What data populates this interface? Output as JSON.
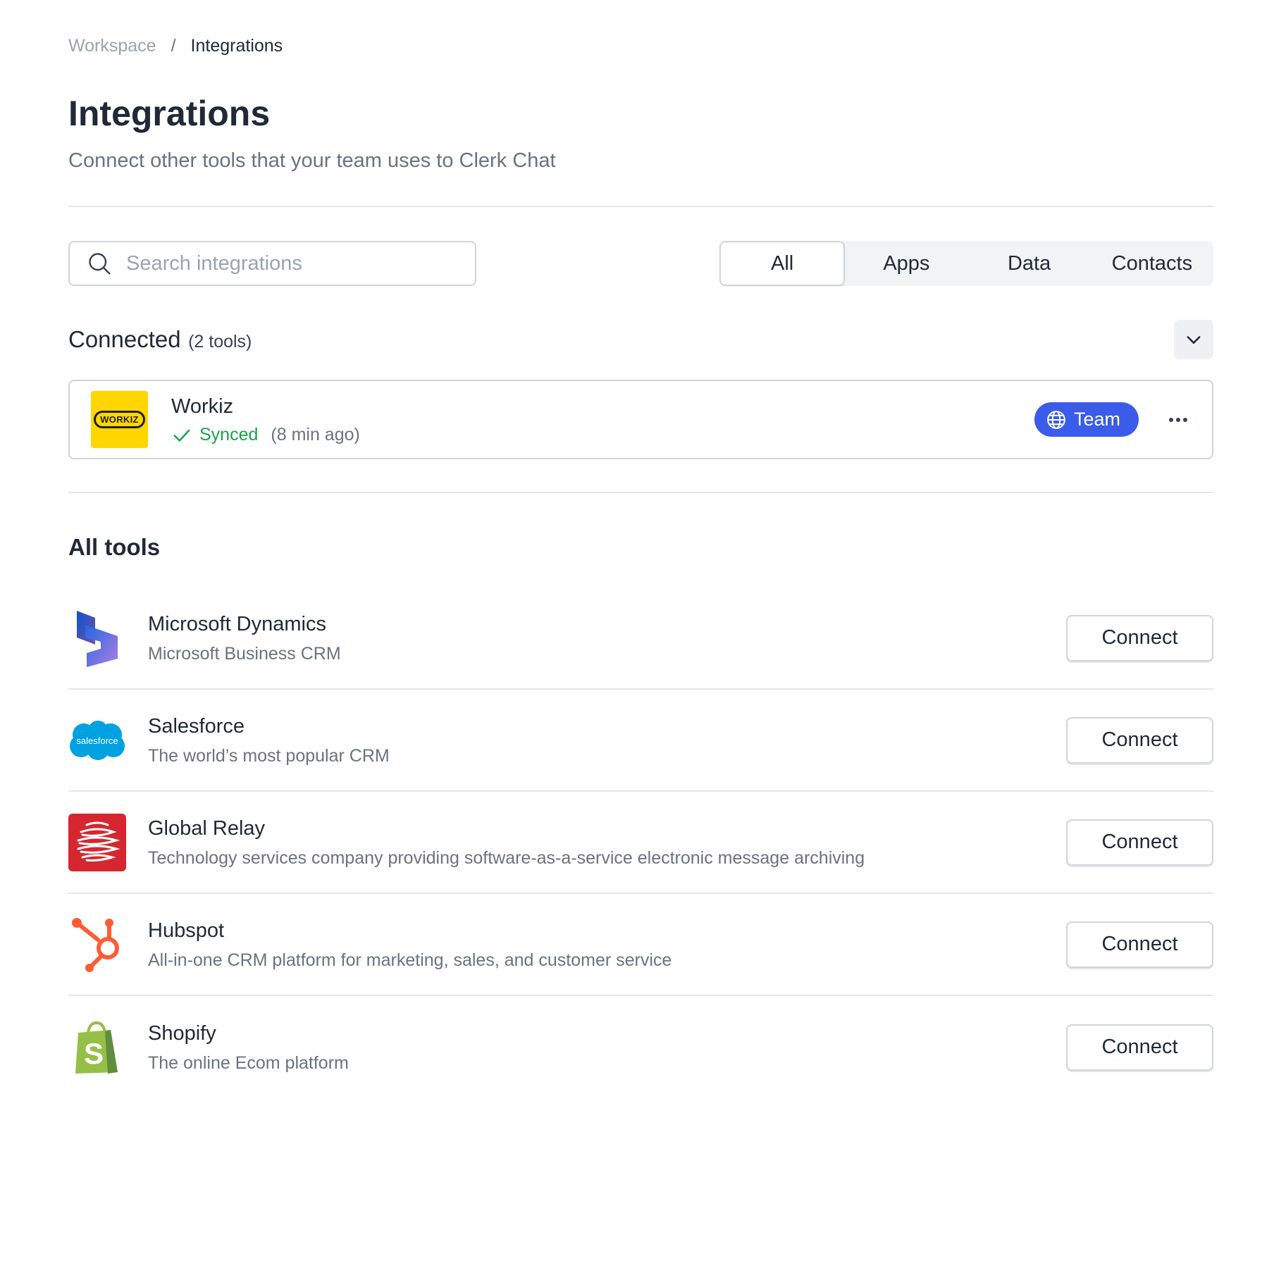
{
  "breadcrumb": {
    "parent": "Workspace",
    "separator": "/",
    "current": "Integrations"
  },
  "header": {
    "title": "Integrations",
    "subtitle": "Connect other tools that your team uses to Clerk Chat"
  },
  "search": {
    "placeholder": "Search integrations",
    "value": ""
  },
  "filters": {
    "tabs": [
      {
        "label": "All",
        "active": true
      },
      {
        "label": "Apps",
        "active": false
      },
      {
        "label": "Data",
        "active": false
      },
      {
        "label": "Contacts",
        "active": false
      }
    ]
  },
  "connected": {
    "title": "Connected",
    "count": "(2 tools)",
    "items": [
      {
        "name": "Workiz",
        "logo_text": "WORKIZ",
        "status": "Synced",
        "time": "(8 min ago)",
        "badge": "Team"
      }
    ]
  },
  "all_tools": {
    "title": "All tools",
    "items": [
      {
        "name": "Microsoft Dynamics",
        "description": "Microsoft Business CRM",
        "action": "Connect",
        "icon": "microsoft-dynamics-icon"
      },
      {
        "name": "Salesforce",
        "description": "The world’s most popular CRM",
        "action": "Connect",
        "icon": "salesforce-icon",
        "logo_text": "salesforce"
      },
      {
        "name": "Global Relay",
        "description": "Technology services company providing software-as-a-service electronic message archiving",
        "action": "Connect",
        "icon": "global-relay-icon"
      },
      {
        "name": "Hubspot",
        "description": "All-in-one CRM platform for marketing, sales, and customer service",
        "action": "Connect",
        "icon": "hubspot-icon"
      },
      {
        "name": "Shopify",
        "description": "The online Ecom platform",
        "action": "Connect",
        "icon": "shopify-icon"
      }
    ]
  },
  "colors": {
    "accent": "#3b5bea",
    "success": "#16a34a",
    "workiz_yellow": "#ffd600",
    "salesforce_blue": "#00a1e0",
    "global_relay_red": "#d6262f",
    "hubspot_orange": "#ff5c35",
    "shopify_green": "#95bf47"
  }
}
